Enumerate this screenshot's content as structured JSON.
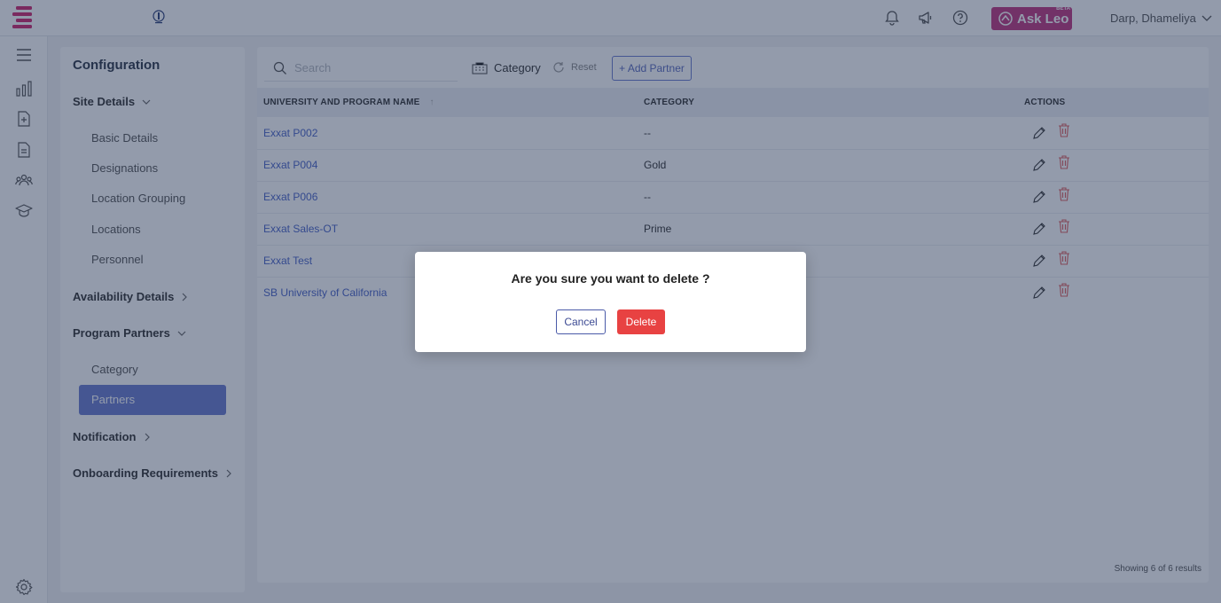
{
  "header": {
    "ask_leo_label": "Ask Leo",
    "ask_leo_badge": "BETA",
    "user_name": "Darp, Dhameliya",
    "icons": [
      "bell-icon",
      "megaphone-icon",
      "help-icon"
    ]
  },
  "rail": {
    "icons": [
      "menu-icon",
      "reports-icon",
      "add-document-icon",
      "document-icon",
      "people-icon",
      "graduation-cap-icon",
      "settings-icon"
    ]
  },
  "sidebar": {
    "title": "Configuration",
    "sections": [
      {
        "label": "Site Details",
        "items": [
          "Basic Details",
          "Designations",
          "Location Grouping",
          "Locations",
          "Personnel"
        ]
      },
      {
        "label": "Availability Details"
      },
      {
        "label": "Program Partners",
        "items": [
          "Category",
          "Partners"
        ]
      },
      {
        "label": "Notification"
      },
      {
        "label": "Onboarding Requirements"
      }
    ],
    "active_item": "Partners"
  },
  "toolbar": {
    "search_placeholder": "Search",
    "category_label": "Category",
    "reset_label": "Reset",
    "add_partner_label": "+ Add Partner"
  },
  "table": {
    "columns": [
      "UNIVERSITY AND PROGRAM NAME",
      "CATEGORY",
      "ACTIONS"
    ],
    "rows": [
      {
        "name": "Exxat P002",
        "category": "--"
      },
      {
        "name": "Exxat P004",
        "category": "Gold"
      },
      {
        "name": "Exxat P006",
        "category": "--"
      },
      {
        "name": "Exxat Sales-OT",
        "category": "Prime"
      },
      {
        "name": "Exxat Test",
        "category": ""
      },
      {
        "name": "SB University of California",
        "category": ""
      }
    ],
    "footer": "Showing 6 of 6 results"
  },
  "modal": {
    "message": "Are you sure you want to delete ?",
    "cancel_label": "Cancel",
    "delete_label": "Delete"
  },
  "colors": {
    "brand": "#c0367f",
    "accent": "#6a7bcf",
    "link": "#4a64c8",
    "danger": "#e84242"
  }
}
